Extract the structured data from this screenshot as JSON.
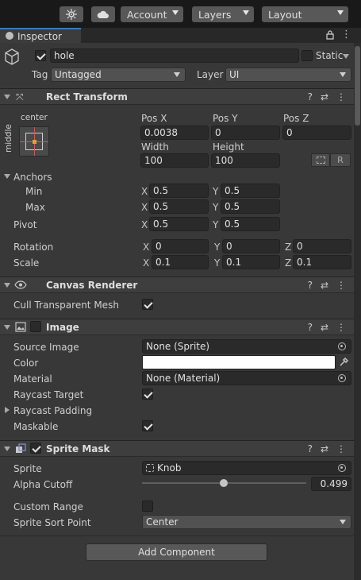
{
  "toolbar": {
    "account": "Account",
    "layers": "Layers",
    "layout": "Layout"
  },
  "tab": {
    "label": "Inspector"
  },
  "object": {
    "name": "hole",
    "active": true,
    "static_label": "Static",
    "tag_label": "Tag",
    "tag_value": "Untagged",
    "layer_label": "Layer",
    "layer_value": "UI"
  },
  "rect_transform": {
    "title": "Rect Transform",
    "anchor_h": "center",
    "anchor_v": "middle",
    "pos_x_label": "Pos X",
    "pos_y_label": "Pos Y",
    "pos_z_label": "Pos Z",
    "pos_x": "0.0038",
    "pos_y": "0",
    "pos_z": "0",
    "width_label": "Width",
    "height_label": "Height",
    "width": "100",
    "height": "100",
    "raw_button": "R",
    "anchors_label": "Anchors",
    "min_label": "Min",
    "max_label": "Max",
    "min_x": "0.5",
    "min_y": "0.5",
    "max_x": "0.5",
    "max_y": "0.5",
    "pivot_label": "Pivot",
    "pivot_x": "0.5",
    "pivot_y": "0.5",
    "rotation_label": "Rotation",
    "rot_x": "0",
    "rot_y": "0",
    "rot_z": "0",
    "scale_label": "Scale",
    "scale_x": "0.1",
    "scale_y": "0.1",
    "scale_z": "0.1",
    "x": "X",
    "y": "Y",
    "z": "Z"
  },
  "canvas_renderer": {
    "title": "Canvas Renderer",
    "cull_label": "Cull Transparent Mesh",
    "cull": true
  },
  "image": {
    "title": "Image",
    "enabled": false,
    "source_label": "Source Image",
    "source_value": "None (Sprite)",
    "color_label": "Color",
    "color_value": "#ffffff",
    "material_label": "Material",
    "material_value": "None (Material)",
    "raycast_target_label": "Raycast Target",
    "raycast_target": true,
    "raycast_padding_label": "Raycast Padding",
    "maskable_label": "Maskable",
    "maskable": true
  },
  "sprite_mask": {
    "title": "Sprite Mask",
    "enabled": true,
    "sprite_label": "Sprite",
    "sprite_value": "Knob",
    "alpha_label": "Alpha Cutoff",
    "alpha_value": "0.499",
    "alpha_fraction": 0.499,
    "custom_range_label": "Custom Range",
    "custom_range": false,
    "sort_point_label": "Sprite Sort Point",
    "sort_point_value": "Center"
  },
  "add_component": "Add Component",
  "colors": {
    "background": "#383838",
    "header": "#3e3e3e",
    "field": "#2a2a2a",
    "accent": "#3a79bb"
  }
}
